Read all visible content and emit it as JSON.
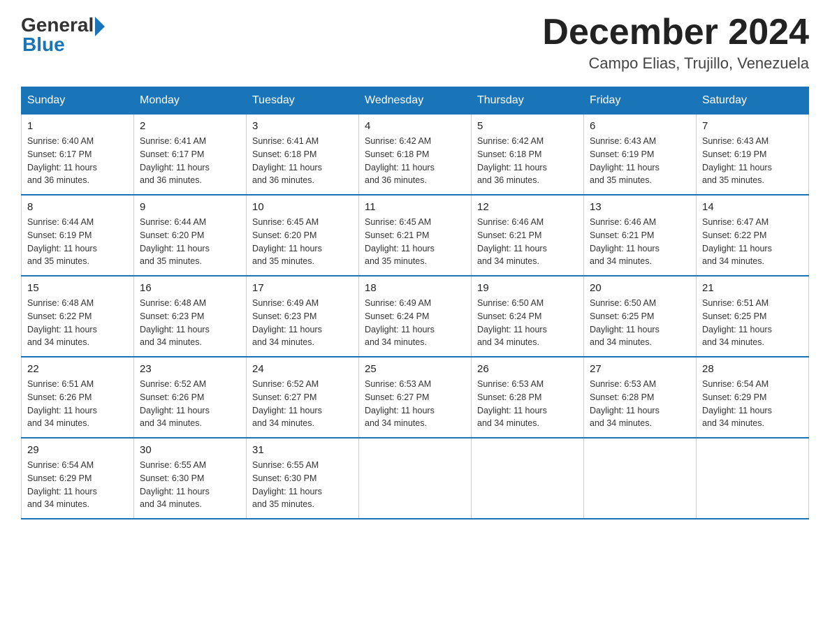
{
  "logo": {
    "general": "General",
    "blue": "Blue"
  },
  "title": {
    "month_year": "December 2024",
    "location": "Campo Elias, Trujillo, Venezuela"
  },
  "headers": [
    "Sunday",
    "Monday",
    "Tuesday",
    "Wednesday",
    "Thursday",
    "Friday",
    "Saturday"
  ],
  "weeks": [
    [
      {
        "day": "1",
        "sunrise": "6:40 AM",
        "sunset": "6:17 PM",
        "daylight": "11 hours and 36 minutes."
      },
      {
        "day": "2",
        "sunrise": "6:41 AM",
        "sunset": "6:17 PM",
        "daylight": "11 hours and 36 minutes."
      },
      {
        "day": "3",
        "sunrise": "6:41 AM",
        "sunset": "6:18 PM",
        "daylight": "11 hours and 36 minutes."
      },
      {
        "day": "4",
        "sunrise": "6:42 AM",
        "sunset": "6:18 PM",
        "daylight": "11 hours and 36 minutes."
      },
      {
        "day": "5",
        "sunrise": "6:42 AM",
        "sunset": "6:18 PM",
        "daylight": "11 hours and 36 minutes."
      },
      {
        "day": "6",
        "sunrise": "6:43 AM",
        "sunset": "6:19 PM",
        "daylight": "11 hours and 35 minutes."
      },
      {
        "day": "7",
        "sunrise": "6:43 AM",
        "sunset": "6:19 PM",
        "daylight": "11 hours and 35 minutes."
      }
    ],
    [
      {
        "day": "8",
        "sunrise": "6:44 AM",
        "sunset": "6:19 PM",
        "daylight": "11 hours and 35 minutes."
      },
      {
        "day": "9",
        "sunrise": "6:44 AM",
        "sunset": "6:20 PM",
        "daylight": "11 hours and 35 minutes."
      },
      {
        "day": "10",
        "sunrise": "6:45 AM",
        "sunset": "6:20 PM",
        "daylight": "11 hours and 35 minutes."
      },
      {
        "day": "11",
        "sunrise": "6:45 AM",
        "sunset": "6:21 PM",
        "daylight": "11 hours and 35 minutes."
      },
      {
        "day": "12",
        "sunrise": "6:46 AM",
        "sunset": "6:21 PM",
        "daylight": "11 hours and 34 minutes."
      },
      {
        "day": "13",
        "sunrise": "6:46 AM",
        "sunset": "6:21 PM",
        "daylight": "11 hours and 34 minutes."
      },
      {
        "day": "14",
        "sunrise": "6:47 AM",
        "sunset": "6:22 PM",
        "daylight": "11 hours and 34 minutes."
      }
    ],
    [
      {
        "day": "15",
        "sunrise": "6:48 AM",
        "sunset": "6:22 PM",
        "daylight": "11 hours and 34 minutes."
      },
      {
        "day": "16",
        "sunrise": "6:48 AM",
        "sunset": "6:23 PM",
        "daylight": "11 hours and 34 minutes."
      },
      {
        "day": "17",
        "sunrise": "6:49 AM",
        "sunset": "6:23 PM",
        "daylight": "11 hours and 34 minutes."
      },
      {
        "day": "18",
        "sunrise": "6:49 AM",
        "sunset": "6:24 PM",
        "daylight": "11 hours and 34 minutes."
      },
      {
        "day": "19",
        "sunrise": "6:50 AM",
        "sunset": "6:24 PM",
        "daylight": "11 hours and 34 minutes."
      },
      {
        "day": "20",
        "sunrise": "6:50 AM",
        "sunset": "6:25 PM",
        "daylight": "11 hours and 34 minutes."
      },
      {
        "day": "21",
        "sunrise": "6:51 AM",
        "sunset": "6:25 PM",
        "daylight": "11 hours and 34 minutes."
      }
    ],
    [
      {
        "day": "22",
        "sunrise": "6:51 AM",
        "sunset": "6:26 PM",
        "daylight": "11 hours and 34 minutes."
      },
      {
        "day": "23",
        "sunrise": "6:52 AM",
        "sunset": "6:26 PM",
        "daylight": "11 hours and 34 minutes."
      },
      {
        "day": "24",
        "sunrise": "6:52 AM",
        "sunset": "6:27 PM",
        "daylight": "11 hours and 34 minutes."
      },
      {
        "day": "25",
        "sunrise": "6:53 AM",
        "sunset": "6:27 PM",
        "daylight": "11 hours and 34 minutes."
      },
      {
        "day": "26",
        "sunrise": "6:53 AM",
        "sunset": "6:28 PM",
        "daylight": "11 hours and 34 minutes."
      },
      {
        "day": "27",
        "sunrise": "6:53 AM",
        "sunset": "6:28 PM",
        "daylight": "11 hours and 34 minutes."
      },
      {
        "day": "28",
        "sunrise": "6:54 AM",
        "sunset": "6:29 PM",
        "daylight": "11 hours and 34 minutes."
      }
    ],
    [
      {
        "day": "29",
        "sunrise": "6:54 AM",
        "sunset": "6:29 PM",
        "daylight": "11 hours and 34 minutes."
      },
      {
        "day": "30",
        "sunrise": "6:55 AM",
        "sunset": "6:30 PM",
        "daylight": "11 hours and 34 minutes."
      },
      {
        "day": "31",
        "sunrise": "6:55 AM",
        "sunset": "6:30 PM",
        "daylight": "11 hours and 35 minutes."
      },
      null,
      null,
      null,
      null
    ]
  ],
  "labels": {
    "sunrise": "Sunrise:",
    "sunset": "Sunset:",
    "daylight": "Daylight:"
  }
}
